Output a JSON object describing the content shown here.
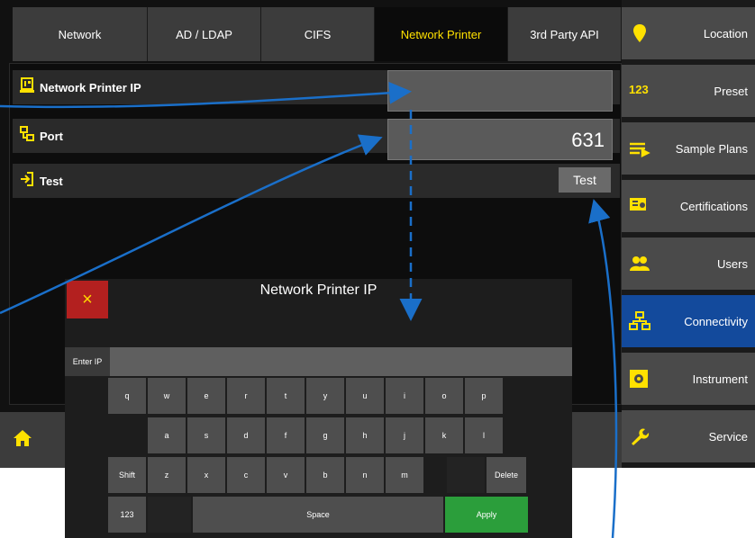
{
  "tabs": [
    {
      "label": "Network"
    },
    {
      "label": "AD / LDAP"
    },
    {
      "label": "CIFS"
    },
    {
      "label": "Network Printer"
    },
    {
      "label": "3rd Party API"
    }
  ],
  "rows": {
    "printer_ip": {
      "label": "Network Printer IP",
      "value": ""
    },
    "port": {
      "label": "Port",
      "value": "631"
    },
    "test": {
      "label": "Test",
      "button": "Test"
    }
  },
  "sidebar": [
    {
      "label": "Location",
      "icon": "location-pin-icon"
    },
    {
      "label": "Preset",
      "icon": "preset-123-icon"
    },
    {
      "label": "Sample Plans",
      "icon": "sample-plans-icon"
    },
    {
      "label": "Certifications",
      "icon": "certifications-icon"
    },
    {
      "label": "Users",
      "icon": "users-icon"
    },
    {
      "label": "Connectivity",
      "icon": "network-icon"
    },
    {
      "label": "Instrument",
      "icon": "instrument-icon"
    },
    {
      "label": "Service",
      "icon": "wrench-icon"
    }
  ],
  "keyboard": {
    "title": "Network Printer IP",
    "close": "×",
    "input_label": "Enter IP",
    "row1": [
      "q",
      "w",
      "e",
      "r",
      "t",
      "y",
      "u",
      "i",
      "o",
      "p"
    ],
    "row2": [
      "a",
      "s",
      "d",
      "f",
      "g",
      "h",
      "j",
      "k",
      "l"
    ],
    "row3": [
      "z",
      "x",
      "c",
      "v",
      "b",
      "n",
      "m"
    ],
    "shift": "Shift",
    "delete": "Delete",
    "num": "123",
    "space": "Space",
    "apply": "Apply"
  },
  "colors": {
    "accent": "#ffe100",
    "active_side": "#134a9c",
    "apply": "#2b9e3b",
    "close": "#b3201f",
    "arrow": "#1a6fc9"
  }
}
